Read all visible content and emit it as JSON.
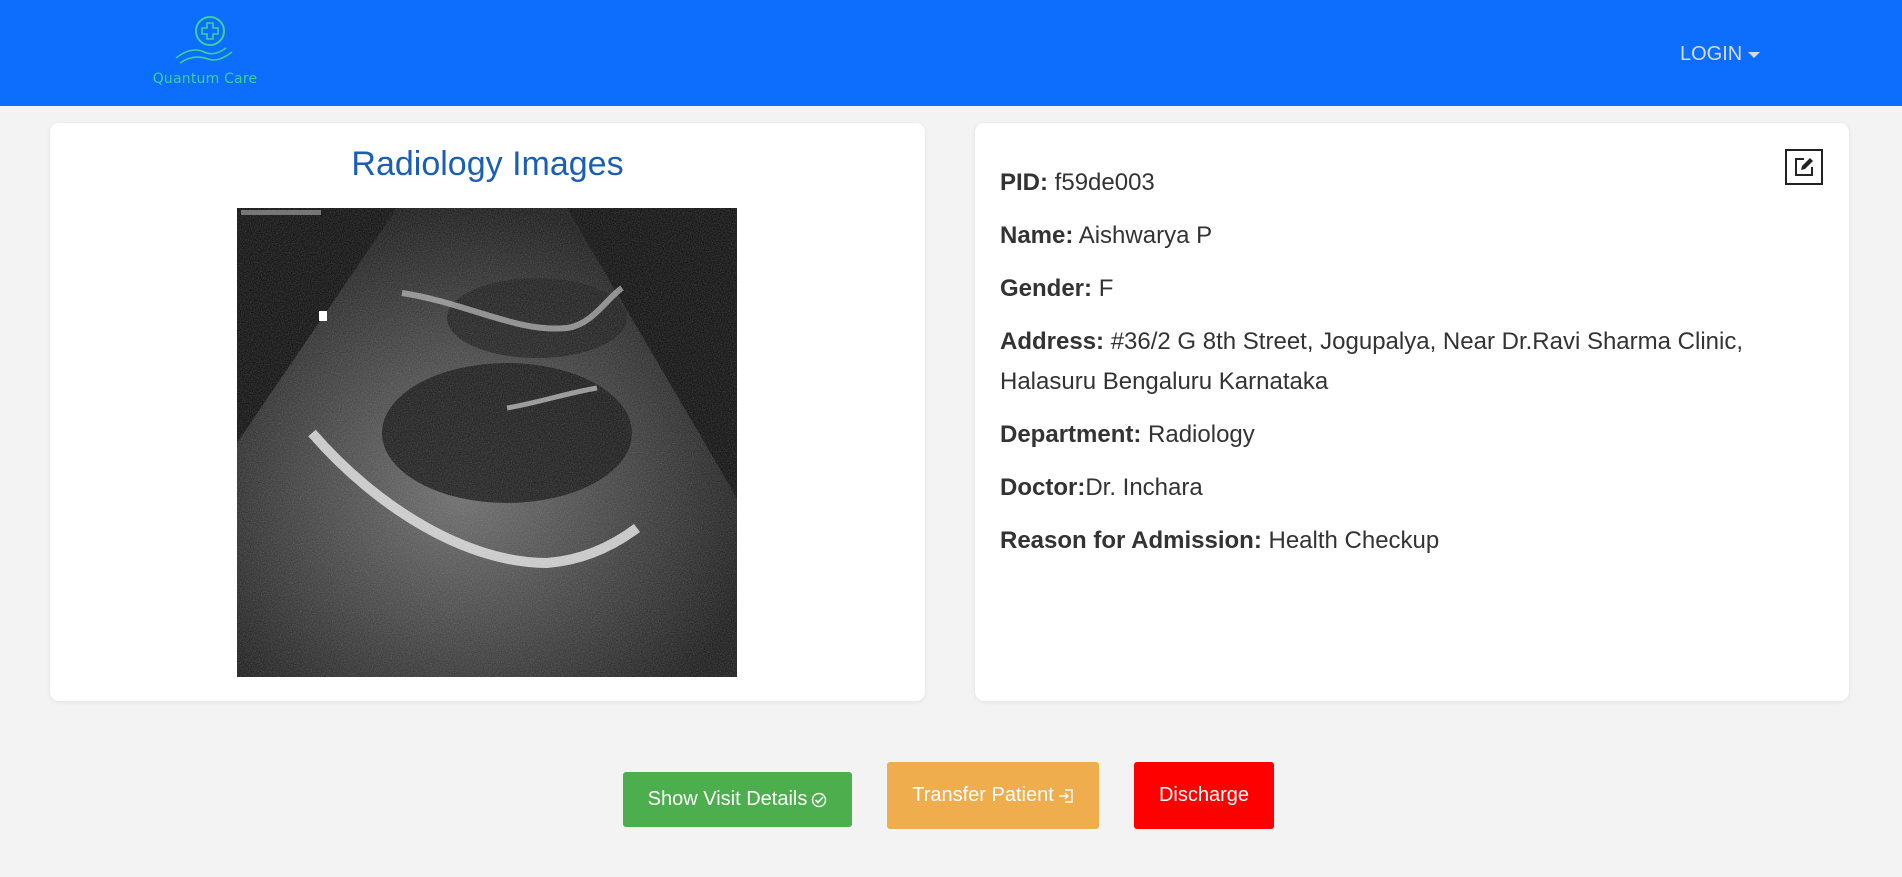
{
  "header": {
    "brand_name": "Quantum Care",
    "login_label": "LOGIN",
    "colors": {
      "bar": "#0d6efd",
      "brand": "#3ecf9a"
    }
  },
  "radiology": {
    "title": "Radiology Images",
    "image": "ultrasound-scan"
  },
  "patient": {
    "pid_label": "PID:",
    "pid": "f59de003",
    "name_label": "Name:",
    "name": "Aishwarya P",
    "gender_label": "Gender:",
    "gender": "F",
    "address_label": "Address:",
    "address": "#36/2 G 8th Street, Jogupalya, Near Dr.Ravi Sharma Clinic, Halasuru Bengaluru Karnataka",
    "department_label": "Department:",
    "department": "Radiology",
    "doctor_label": "Doctor:",
    "doctor": "Dr. Inchara",
    "reason_label": "Reason for Admission:",
    "reason": "Health Checkup",
    "edit_icon": "edit-icon"
  },
  "actions": {
    "visit_label": "Show Visit Details",
    "transfer_label": "Transfer Patient",
    "discharge_label": "Discharge",
    "colors": {
      "visit": "#4cae4c",
      "transfer": "#f0ad4e",
      "discharge": "#ff0000"
    }
  }
}
